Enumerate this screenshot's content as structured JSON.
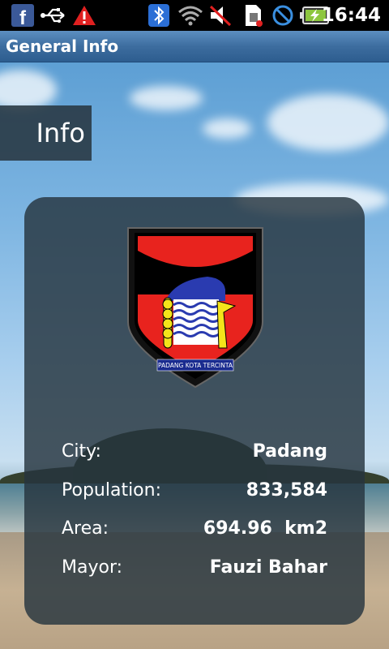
{
  "status_bar": {
    "time": "16:44",
    "icons": [
      "facebook-icon",
      "usb-icon",
      "warning-icon",
      "bluetooth-icon",
      "wifi-icon",
      "muted-icon",
      "sim-icon",
      "no-signal-icon",
      "battery-charging-icon"
    ]
  },
  "header": {
    "title": "General Info"
  },
  "tab": {
    "label": "Info"
  },
  "card": {
    "emblem_text": "PADANG KOTA TERCINTA",
    "rows": [
      {
        "label": "City:",
        "value": "Padang"
      },
      {
        "label": "Population:",
        "value": "833,584"
      },
      {
        "label": "Area:",
        "value": "694.96  km2"
      },
      {
        "label": "Mayor:",
        "value": "Fauzi Bahar"
      }
    ]
  },
  "colors": {
    "title_bar": "#3d6d9f",
    "card_bg": "#26343e",
    "emblem_red": "#e8231e",
    "emblem_blue": "#2a3bb0",
    "emblem_yellow": "#f4e41a"
  }
}
